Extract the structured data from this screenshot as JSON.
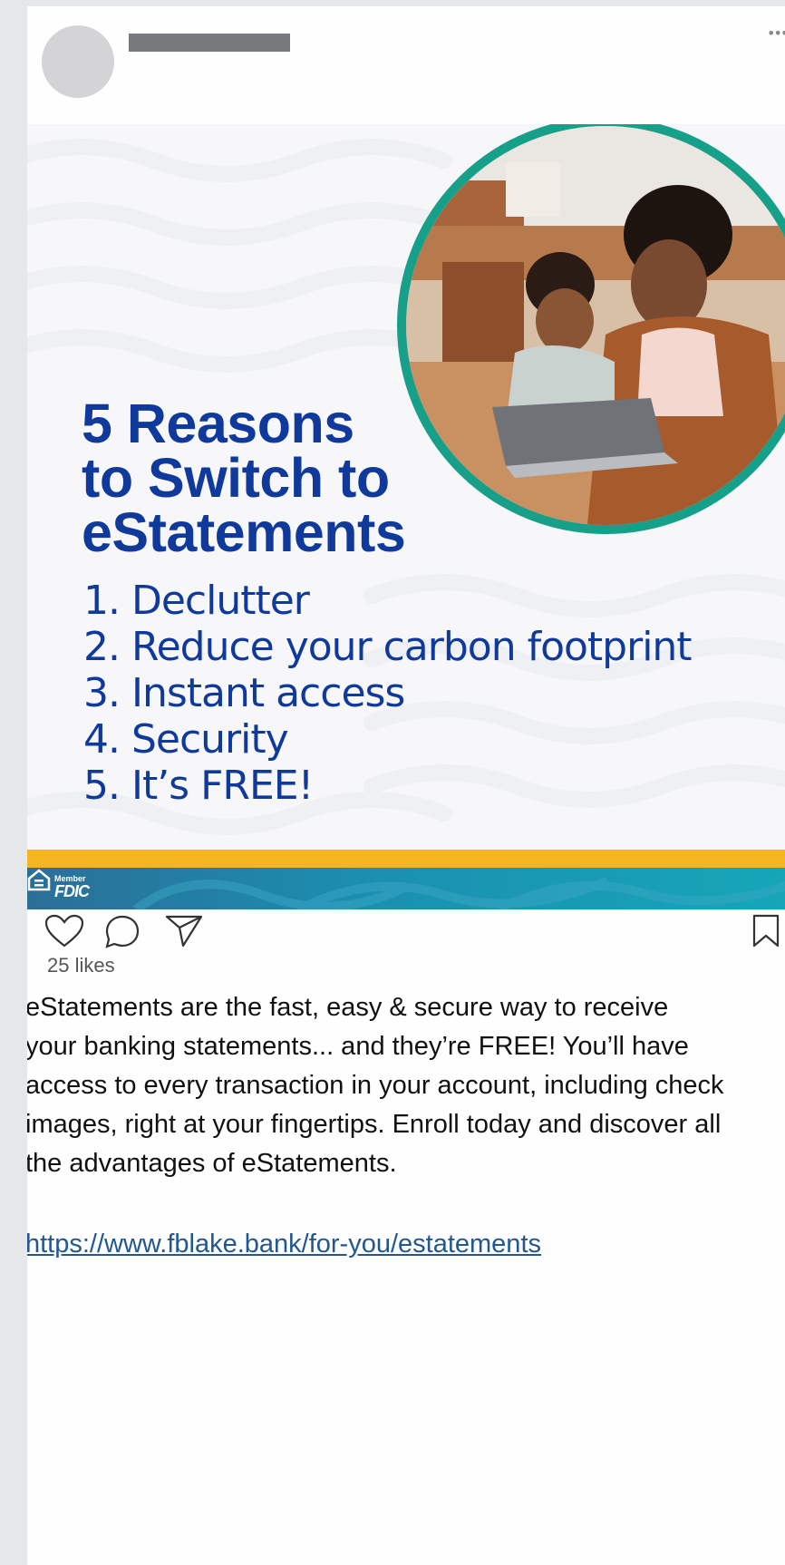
{
  "post": {
    "more_icon": "more-horizontal-icon",
    "image": {
      "headline_lines": [
        "5 Reasons",
        "to Switch to",
        "eStatements"
      ],
      "reasons": [
        "1. Declutter",
        "2. Reduce your carbon footprint",
        "3. Instant access",
        "4. Security",
        "5. It’s FREE!"
      ],
      "fdic_member": "Member",
      "fdic_name": "FDIC",
      "colors": {
        "headline": "#0f3a9c",
        "ring": "#16a08a",
        "stripe": "#f3b521",
        "band": "#1b8fb0"
      }
    },
    "actions": {
      "like_icon": "heart-icon",
      "comment_icon": "comment-icon",
      "share_icon": "send-icon",
      "save_icon": "bookmark-icon"
    },
    "likes": "25 likes",
    "caption_lines": [
      "eStatements are the fast, easy & secure way to receive",
      "your banking statements... and they’re FREE! You’ll have",
      "access to every transaction in your account, including check",
      "images, right at your fingertips. Enroll today and discover all",
      "the advantages of eStatements."
    ],
    "link": "https://www.fblake.bank/for-you/estatements"
  }
}
